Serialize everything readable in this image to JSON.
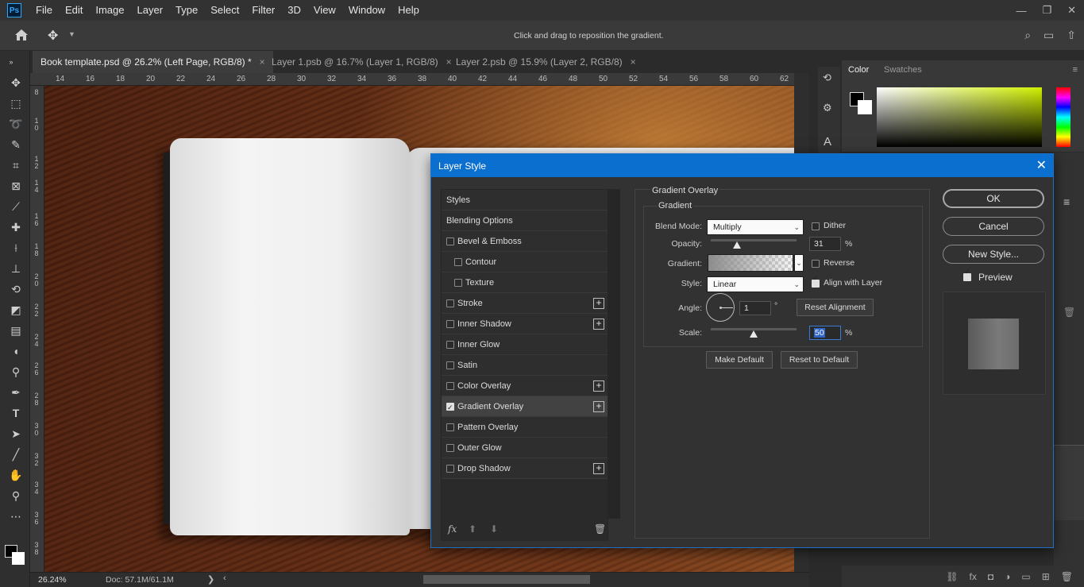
{
  "app": {
    "logo": "Ps"
  },
  "menu": [
    "File",
    "Edit",
    "Image",
    "Layer",
    "Type",
    "Select",
    "Filter",
    "3D",
    "View",
    "Window",
    "Help"
  ],
  "window_controls": {
    "minimize": "—",
    "restore": "❐",
    "close": "✕"
  },
  "options_bar": {
    "hint": "Click and drag to reposition the gradient."
  },
  "tabs": [
    {
      "label": "Book template.psd @ 26.2% (Left Page, RGB/8) *",
      "close": "×",
      "active": true
    },
    {
      "label": "Layer 1.psb @ 16.7% (Layer 1, RGB/8)",
      "close": "×",
      "active": false
    },
    {
      "label": "Layer 2.psb @ 15.9% (Layer 2, RGB/8)",
      "close": "×",
      "active": false
    }
  ],
  "ruler_top": [
    "14",
    "16",
    "18",
    "20",
    "22",
    "24",
    "26",
    "28",
    "30",
    "32",
    "34",
    "36",
    "38",
    "40",
    "42",
    "44",
    "46",
    "48",
    "50",
    "52",
    "54",
    "56",
    "58",
    "60",
    "62"
  ],
  "ruler_left": [
    [
      "8"
    ],
    [
      "1",
      "0"
    ],
    [
      "1",
      "2"
    ],
    [
      "1",
      "4"
    ],
    [
      "1",
      "6"
    ],
    [
      "1",
      "8"
    ],
    [
      "2",
      "0"
    ],
    [
      "2",
      "2"
    ],
    [
      "2",
      "4"
    ],
    [
      "2",
      "6"
    ],
    [
      "2",
      "8"
    ],
    [
      "3",
      "0"
    ],
    [
      "3",
      "2"
    ],
    [
      "3",
      "4"
    ],
    [
      "3",
      "6"
    ],
    [
      "3",
      "8"
    ]
  ],
  "status": {
    "zoom": "26.24%",
    "doc": "Doc: 57.1M/61.1M",
    "nav_right": "❯",
    "nav_left": "‹"
  },
  "color_panel": {
    "tab_color": "Color",
    "tab_swatches": "Swatches"
  },
  "dialog": {
    "title": "Layer Style",
    "close": "✕",
    "styles_header": "Styles",
    "blending_options": "Blending Options",
    "effects": [
      {
        "label": "Bevel & Emboss",
        "checked": false,
        "indent": false,
        "plus": false
      },
      {
        "label": "Contour",
        "checked": false,
        "indent": true,
        "plus": false
      },
      {
        "label": "Texture",
        "checked": false,
        "indent": true,
        "plus": false
      },
      {
        "label": "Stroke",
        "checked": false,
        "indent": false,
        "plus": true
      },
      {
        "label": "Inner Shadow",
        "checked": false,
        "indent": false,
        "plus": true
      },
      {
        "label": "Inner Glow",
        "checked": false,
        "indent": false,
        "plus": false
      },
      {
        "label": "Satin",
        "checked": false,
        "indent": false,
        "plus": false
      },
      {
        "label": "Color Overlay",
        "checked": false,
        "indent": false,
        "plus": true
      },
      {
        "label": "Gradient Overlay",
        "checked": true,
        "indent": false,
        "plus": true,
        "selected": true
      },
      {
        "label": "Pattern Overlay",
        "checked": false,
        "indent": false,
        "plus": false
      },
      {
        "label": "Outer Glow",
        "checked": false,
        "indent": false,
        "plus": false
      },
      {
        "label": "Drop Shadow",
        "checked": false,
        "indent": false,
        "plus": true
      }
    ],
    "list_footer": {
      "fx": "fx",
      "up": "⬆",
      "down": "⬇",
      "trash": "🗑"
    },
    "group_title": "Gradient Overlay",
    "subgroup_title": "Gradient",
    "blend_mode": {
      "label": "Blend Mode:",
      "value": "Multiply"
    },
    "dither": {
      "label": "Dither",
      "checked": false
    },
    "opacity": {
      "label": "Opacity:",
      "value": "31",
      "unit": "%",
      "level": 0.31
    },
    "gradient": {
      "label": "Gradient:"
    },
    "reverse": {
      "label": "Reverse",
      "checked": false
    },
    "style": {
      "label": "Style:",
      "value": "Linear"
    },
    "align_with_layer": {
      "label": "Align with Layer",
      "checked": true
    },
    "angle": {
      "label": "Angle:",
      "value": "1",
      "unit": "°"
    },
    "reset_alignment": "Reset Alignment",
    "scale": {
      "label": "Scale:",
      "value": "50",
      "unit": "%",
      "level": 0.5
    },
    "make_default": "Make Default",
    "reset_to_default": "Reset to Default",
    "buttons": {
      "ok": "OK",
      "cancel": "Cancel",
      "new_style": "New Style..."
    },
    "preview": {
      "label": "Preview",
      "checked": true
    }
  }
}
